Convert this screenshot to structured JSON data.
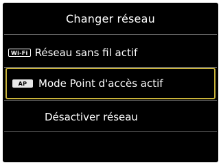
{
  "screen": {
    "title": "Changer réseau"
  },
  "menu": {
    "items": [
      {
        "badge": "Wi-Fi",
        "label": "Réseau sans fil actif",
        "icon": "wifi-badge-icon",
        "selected": false
      },
      {
        "badge": "AP",
        "label": "Mode Point d'accès actif",
        "icon": "ap-badge-icon",
        "selected": true
      },
      {
        "badge": "",
        "label": "Désactiver réseau",
        "icon": "",
        "selected": false
      }
    ]
  },
  "colors": {
    "background": "#000000",
    "text": "#ffffff",
    "selection_border": "#c9b33a",
    "divider": "#6a6a6a"
  }
}
